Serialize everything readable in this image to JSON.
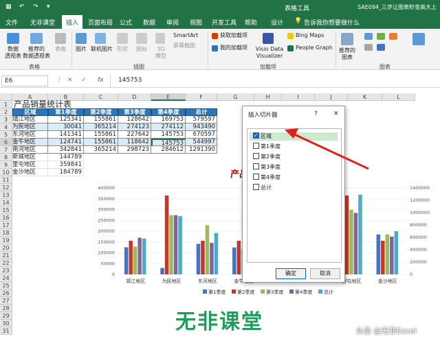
{
  "titlebar": {
    "file_name": "SAE094_三步让图表秒变高大上",
    "tools_label": "表格工具"
  },
  "tabs": [
    "文件",
    "无非课堂",
    "插入",
    "页面布局",
    "公式",
    "数据",
    "审阅",
    "视图",
    "开发工具",
    "帮助",
    "设计"
  ],
  "tell_me": "告诉我你想要做什么",
  "ribbon": {
    "pivot": "数据\n透视表",
    "rec_pivot": "推荐的\n数据透视表",
    "table": "表格",
    "group_tables": "表格",
    "picture": "图片",
    "online_pic": "联机图片",
    "shapes": "形状",
    "icons": "图标",
    "model3d": "3D\n模型",
    "smartart": "SmartArt",
    "screenshot": "屏幕截图",
    "group_illus": "插图",
    "get_addins": "获取加载项",
    "my_addins": "我的加载项",
    "visio": "Visio Data\nVisualizer",
    "bing": "Bing Maps",
    "people": "People Graph",
    "group_addins": "加载项",
    "rec_charts": "推荐的\n图表",
    "group_charts": "图表"
  },
  "formula_bar": {
    "name_box": "E6",
    "value": "145753",
    "fx": "fx"
  },
  "columns": [
    "A",
    "B",
    "C",
    "D",
    "E",
    "F",
    "G",
    "H",
    "I",
    "J",
    "K",
    "L"
  ],
  "rows": [
    "1",
    "2",
    "3",
    "4",
    "5",
    "6",
    "7",
    "8",
    "9",
    "10",
    "11",
    "12",
    "13",
    "14",
    "15",
    "16",
    "17",
    "18",
    "19",
    "20",
    "21",
    "22",
    "23",
    "24",
    "25",
    "26",
    "27",
    "28",
    "29",
    "30",
    "31"
  ],
  "sheet": {
    "title": "产品销量统计表",
    "headers": [
      "区域",
      "第1季度",
      "第2季度",
      "第3季度",
      "第4季度",
      "总计"
    ],
    "data": [
      [
        "靖江地区",
        "125341",
        "155861",
        "128642",
        "169753",
        "579597"
      ],
      [
        "为民地区",
        "30041",
        "365214",
        "274123",
        "274112",
        "943490"
      ],
      [
        "东河地区",
        "141341",
        "155861",
        "227642",
        "145753",
        "670597"
      ],
      [
        "金牛地区",
        "124741",
        "155861",
        "118642",
        "145753",
        "544997"
      ],
      [
        "南河地区",
        "342841",
        "365214",
        "298723",
        "284612",
        "1291390"
      ]
    ],
    "extra": [
      [
        "新城地区",
        "144789"
      ],
      [
        "里屯地区",
        "359841"
      ],
      [
        "金沙地区",
        "184789"
      ]
    ]
  },
  "chart_data": {
    "type": "bar",
    "title": "产品",
    "categories": [
      "靖江地区",
      "为民地区",
      "东河地区",
      "金牛地区",
      "",
      "",
      "里屯地区",
      "金沙地区"
    ],
    "series": [
      {
        "name": "第1季度",
        "values": [
          125341,
          30041,
          141341,
          124741,
          null,
          null,
          359841,
          184789
        ]
      },
      {
        "name": "第2季度",
        "values": [
          155861,
          365214,
          155861,
          155861,
          null,
          null,
          365214,
          155861
        ]
      },
      {
        "name": "第3季度",
        "values": [
          128642,
          274123,
          227642,
          118642,
          null,
          null,
          298723,
          185000
        ]
      },
      {
        "name": "第4季度",
        "values": [
          169753,
          274112,
          145753,
          145753,
          null,
          null,
          284612,
          175000
        ]
      },
      {
        "name": "总计",
        "values": [
          579597,
          943490,
          670597,
          544997,
          null,
          null,
          1291390,
          700000
        ]
      }
    ],
    "ylim": [
      0,
      400000
    ],
    "y_ticks": [
      "0",
      "50000",
      "100000",
      "150000",
      "200000",
      "250000",
      "300000",
      "350000",
      "400000"
    ],
    "y2lim": [
      0,
      1400000
    ],
    "y2_ticks": [
      "0",
      "200000",
      "400000",
      "600000",
      "800000",
      "1000000",
      "1200000",
      "1400000"
    ],
    "colors": [
      "#4472c4",
      "#c0392b",
      "#9bbb59",
      "#8064a2",
      "#4bacc6"
    ],
    "legend_position": "bottom"
  },
  "dialog": {
    "title": "插入切片器",
    "help": "?",
    "close": "✕",
    "options": [
      {
        "label": "区域",
        "checked": true
      },
      {
        "label": "第1季度",
        "checked": false
      },
      {
        "label": "第2季度",
        "checked": false
      },
      {
        "label": "第3季度",
        "checked": false
      },
      {
        "label": "第4季度",
        "checked": false
      },
      {
        "label": "总计",
        "checked": false
      }
    ],
    "ok": "确定",
    "cancel": "取消"
  },
  "watermark": {
    "logo": "无非课堂",
    "credit": "头条 @无非Excel"
  }
}
